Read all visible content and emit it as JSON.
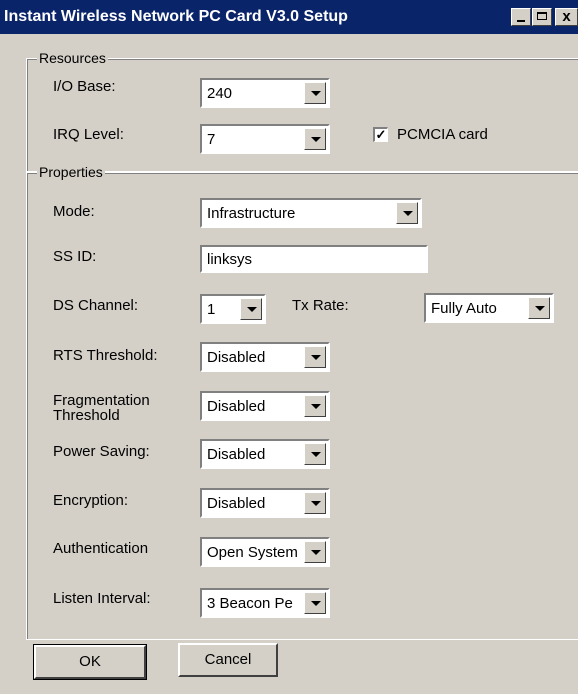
{
  "window": {
    "title": "Instant Wireless Network PC Card V3.0 Setup",
    "close_glyph": "x"
  },
  "resources": {
    "label": "Resources",
    "io_base": {
      "label": "I/O Base:",
      "value": "240"
    },
    "irq_level": {
      "label": "IRQ Level:",
      "value": "7"
    },
    "pcmcia": {
      "label": "PCMCIA card",
      "checked": true,
      "check_glyph": "✓"
    }
  },
  "properties": {
    "label": "Properties",
    "mode": {
      "label": "Mode:",
      "value": "Infrastructure"
    },
    "ssid": {
      "label": "SS ID:",
      "value": "linksys"
    },
    "ds_channel": {
      "label": "DS Channel:",
      "value": "1"
    },
    "tx_rate": {
      "label": "Tx Rate:",
      "value": "Fully Auto"
    },
    "rts_threshold": {
      "label": "RTS Threshold:",
      "value": "Disabled"
    },
    "fragmentation_threshold": {
      "label": "Fragmentation Threshold",
      "value": "Disabled"
    },
    "power_saving": {
      "label": "Power Saving:",
      "value": "Disabled"
    },
    "encryption": {
      "label": "Encryption:",
      "value": "Disabled"
    },
    "authentication": {
      "label": "Authentication",
      "value": "Open System"
    },
    "listen_interval": {
      "label": "Listen Interval:",
      "value": "3 Beacon Pe"
    }
  },
  "buttons": {
    "ok": "OK",
    "cancel": "Cancel"
  },
  "colors": {
    "titlebar": "#0a246a",
    "face": "#d4d0c8",
    "field": "#ffffff"
  }
}
